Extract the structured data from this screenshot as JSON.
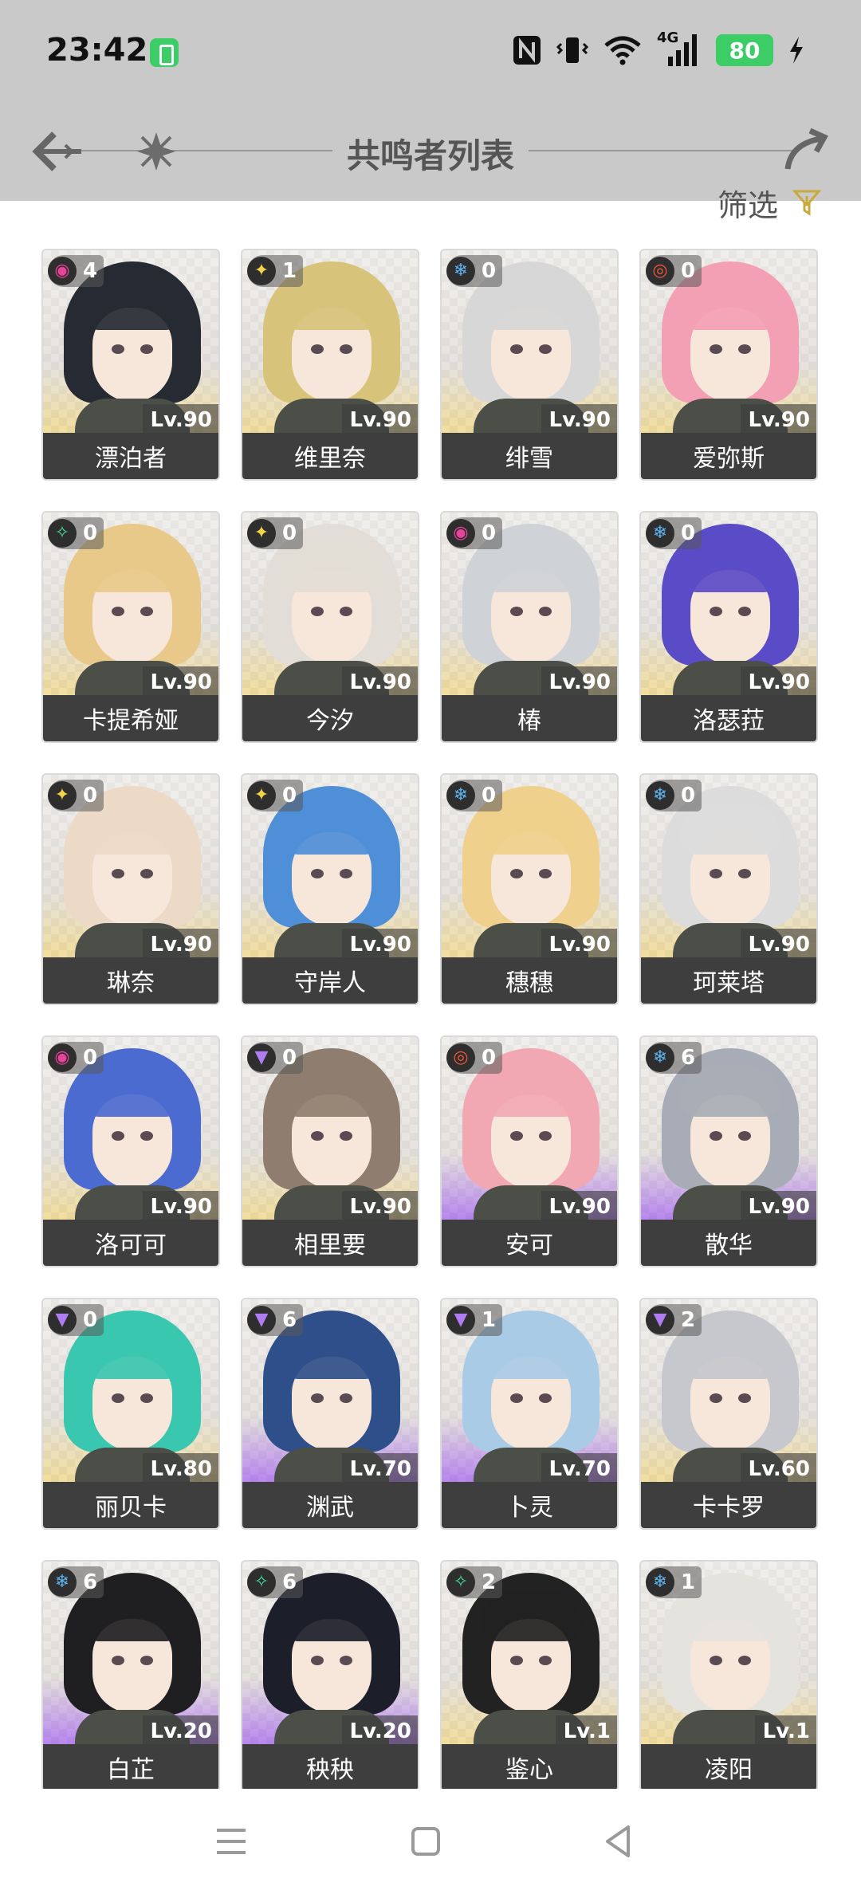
{
  "status_bar": {
    "time": "23:42",
    "network": "4G",
    "battery": "80",
    "icons": [
      "vpn-icon",
      "nfc-icon",
      "vibrate-icon",
      "wifi-icon",
      "cellular-signal-icon",
      "charging-icon"
    ]
  },
  "header": {
    "title": "共鸣者列表",
    "back_icon": "arrow-left-icon",
    "forward_icon": "arrow-right-icon"
  },
  "filter": {
    "label": "筛选",
    "icon": "funnel-icon"
  },
  "element_colors": {
    "havoc": "#e8439a",
    "spectro": "#f4d34a",
    "glacio": "#5fb4f2",
    "fusion": "#f0563a",
    "aero": "#48d99a",
    "electro": "#b07cf2"
  },
  "rarity_colors": {
    "5": "#f2dd9a",
    "4": "#b782f0"
  },
  "characters": [
    {
      "name": "漂泊者",
      "level": "Lv.90",
      "sequence": "4",
      "element": "havoc",
      "rarity": "5",
      "hair": "#262a33"
    },
    {
      "name": "维里奈",
      "level": "Lv.90",
      "sequence": "1",
      "element": "spectro",
      "rarity": "5",
      "hair": "#d8c37a"
    },
    {
      "name": "绯雪",
      "level": "Lv.90",
      "sequence": "0",
      "element": "glacio",
      "rarity": "5",
      "hair": "#d7d7d7"
    },
    {
      "name": "爱弥斯",
      "level": "Lv.90",
      "sequence": "0",
      "element": "fusion",
      "rarity": "5",
      "hair": "#f3a0b4"
    },
    {
      "name": "卡提希娅",
      "level": "Lv.90",
      "sequence": "0",
      "element": "aero",
      "rarity": "5",
      "hair": "#e8c98a"
    },
    {
      "name": "今汐",
      "level": "Lv.90",
      "sequence": "0",
      "element": "spectro",
      "rarity": "5",
      "hair": "#e2ddd6"
    },
    {
      "name": "椿",
      "level": "Lv.90",
      "sequence": "0",
      "element": "havoc",
      "rarity": "5",
      "hair": "#cfd3d8"
    },
    {
      "name": "洛瑟菈",
      "level": "Lv.90",
      "sequence": "0",
      "element": "glacio",
      "rarity": "5",
      "hair": "#5a4bc6"
    },
    {
      "name": "琳奈",
      "level": "Lv.90",
      "sequence": "0",
      "element": "spectro",
      "rarity": "5",
      "hair": "#ecd9c6"
    },
    {
      "name": "守岸人",
      "level": "Lv.90",
      "sequence": "0",
      "element": "spectro",
      "rarity": "5",
      "hair": "#4f8fd8"
    },
    {
      "name": "穗穗",
      "level": "Lv.90",
      "sequence": "0",
      "element": "glacio",
      "rarity": "5",
      "hair": "#efd08c"
    },
    {
      "name": "珂莱塔",
      "level": "Lv.90",
      "sequence": "0",
      "element": "glacio",
      "rarity": "5",
      "hair": "#dcdcdc"
    },
    {
      "name": "洛可可",
      "level": "Lv.90",
      "sequence": "0",
      "element": "havoc",
      "rarity": "5",
      "hair": "#4c6bd0"
    },
    {
      "name": "相里要",
      "level": "Lv.90",
      "sequence": "0",
      "element": "electro",
      "rarity": "5",
      "hair": "#8f7e6f"
    },
    {
      "name": "安可",
      "level": "Lv.90",
      "sequence": "0",
      "element": "fusion",
      "rarity": "4",
      "hair": "#f1a8b2"
    },
    {
      "name": "散华",
      "level": "Lv.90",
      "sequence": "6",
      "element": "glacio",
      "rarity": "4",
      "hair": "#a8acb6"
    },
    {
      "name": "丽贝卡",
      "level": "Lv.80",
      "sequence": "0",
      "element": "electro",
      "rarity": "5",
      "hair": "#39c7b0"
    },
    {
      "name": "渊武",
      "level": "Lv.70",
      "sequence": "6",
      "element": "electro",
      "rarity": "4",
      "hair": "#2f4f8a"
    },
    {
      "name": "卜灵",
      "level": "Lv.70",
      "sequence": "1",
      "element": "electro",
      "rarity": "4",
      "hair": "#a9cbe6"
    },
    {
      "name": "卡卡罗",
      "level": "Lv.60",
      "sequence": "2",
      "element": "electro",
      "rarity": "5",
      "hair": "#c6c8cd"
    },
    {
      "name": "白芷",
      "level": "Lv.20",
      "sequence": "6",
      "element": "glacio",
      "rarity": "4",
      "hair": "#1f1f22"
    },
    {
      "name": "秧秧",
      "level": "Lv.20",
      "sequence": "6",
      "element": "aero",
      "rarity": "4",
      "hair": "#1c1e2a"
    },
    {
      "name": "鉴心",
      "level": "Lv.1",
      "sequence": "2",
      "element": "aero",
      "rarity": "5",
      "hair": "#222222"
    },
    {
      "name": "凌阳",
      "level": "Lv.1",
      "sequence": "1",
      "element": "glacio",
      "rarity": "5",
      "hair": "#e5e3de"
    }
  ],
  "system_nav": {
    "menu_icon": "menu-icon",
    "home_icon": "home-icon",
    "back_icon": "back-triangle-icon"
  }
}
